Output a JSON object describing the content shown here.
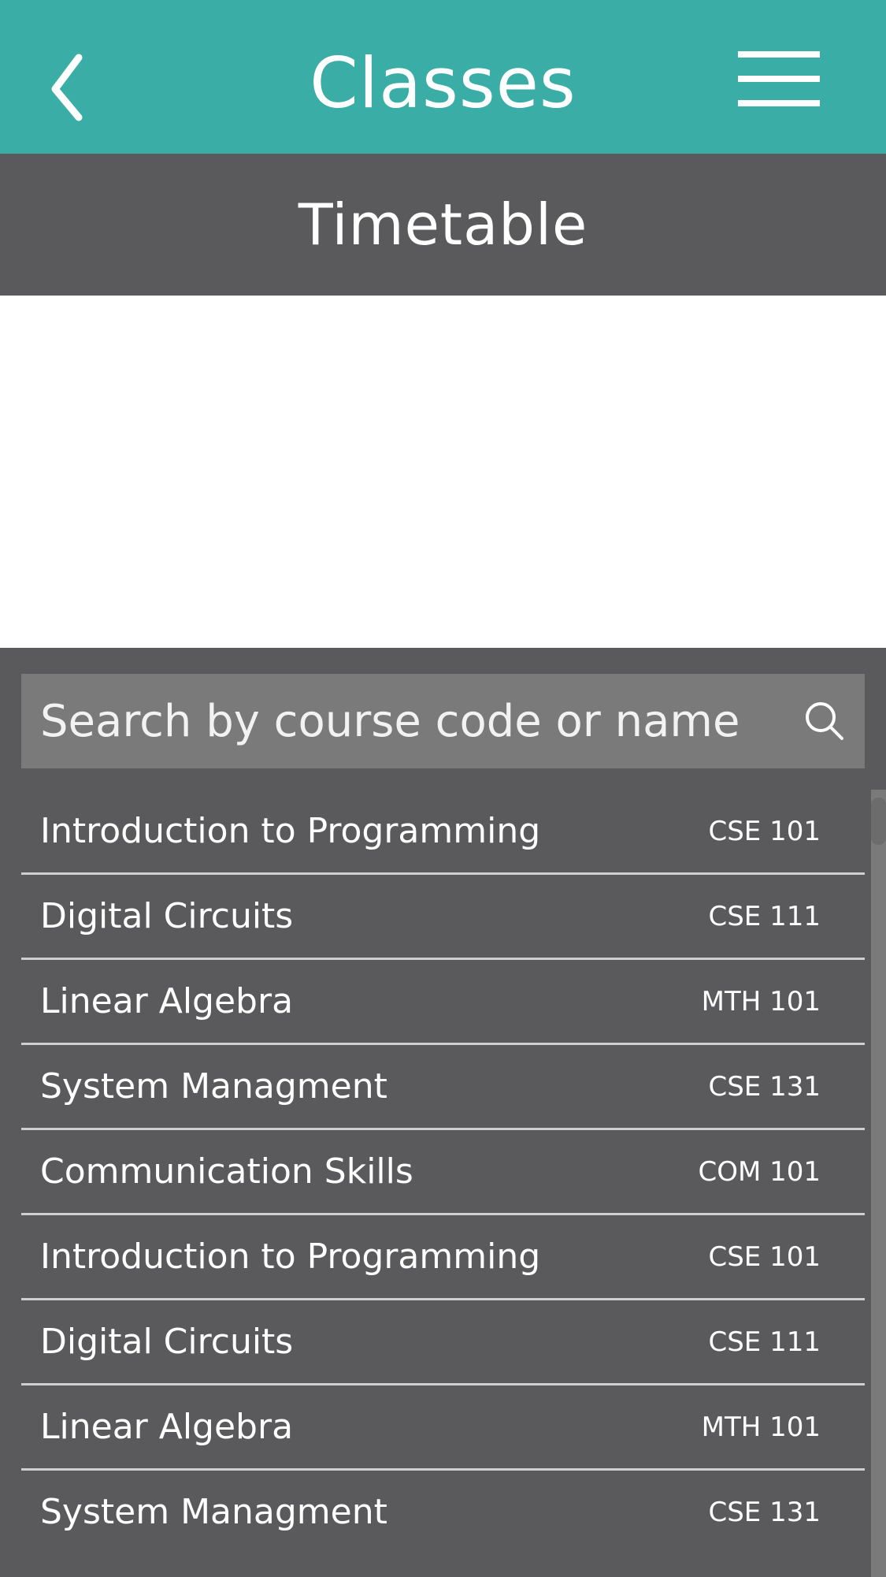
{
  "header": {
    "title": "Classes",
    "color": "#3aaea6",
    "back_icon": "chevron-left-icon",
    "menu_icon": "hamburger-menu-icon"
  },
  "subheader": {
    "title": "Timetable"
  },
  "search": {
    "placeholder": "Search by course code or name",
    "icon": "search-icon"
  },
  "courses": [
    {
      "name": "Introduction to Programming",
      "code": "CSE 101"
    },
    {
      "name": "Digital Circuits",
      "code": "CSE 111"
    },
    {
      "name": "Linear Algebra",
      "code": "MTH 101"
    },
    {
      "name": "System Managment",
      "code": "CSE 131"
    },
    {
      "name": "Communication Skills",
      "code": "COM 101"
    },
    {
      "name": "Introduction to Programming",
      "code": "CSE 101"
    },
    {
      "name": "Digital Circuits",
      "code": "CSE 111"
    },
    {
      "name": "Linear Algebra",
      "code": "MTH 101"
    },
    {
      "name": "System Managment",
      "code": "CSE 131"
    }
  ]
}
